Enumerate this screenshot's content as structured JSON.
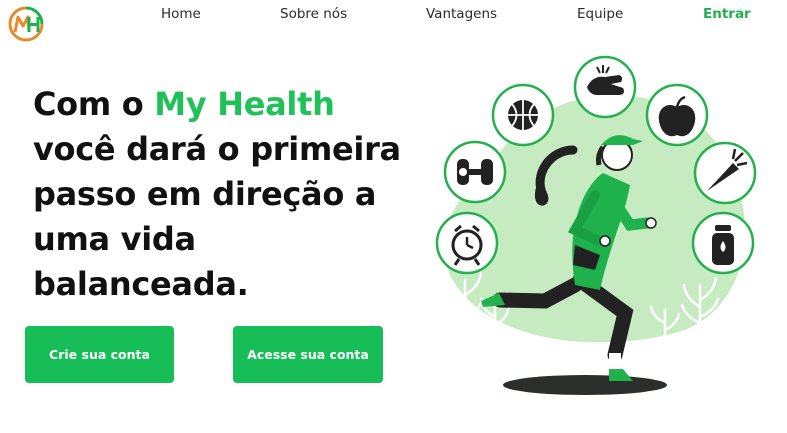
{
  "brand": {
    "logo_initials": "MH",
    "colors": {
      "green": "#1fb14c",
      "orange": "#e8892b",
      "dark": "#222222"
    }
  },
  "nav": {
    "items": [
      {
        "label": "Home"
      },
      {
        "label": "Sobre nós"
      },
      {
        "label": "Vantagens"
      },
      {
        "label": "Equipe"
      }
    ],
    "login_label": "Entrar"
  },
  "hero": {
    "headline_prefix": "Com o ",
    "brand_name": "My Health",
    "headline_rest": "você dará o primeira passo em direção a uma vida balanceada.",
    "illustration_icons": [
      "clock-icon",
      "dumbbell-icon",
      "basketball-icon",
      "stretching-hands-icon",
      "apple-icon",
      "carrot-icon",
      "water-bottle-icon"
    ]
  },
  "actions": {
    "signup_label": "Crie sua conta",
    "access_label": "Acesse sua conta"
  }
}
